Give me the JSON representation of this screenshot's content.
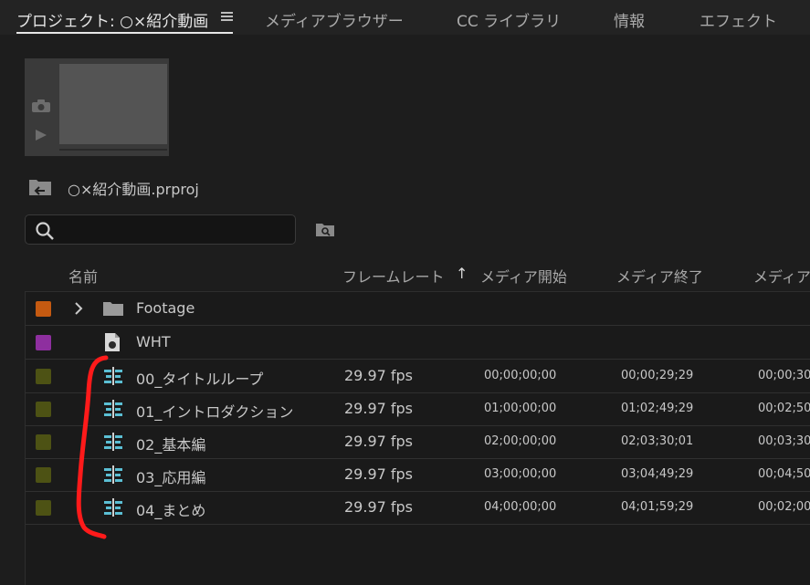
{
  "tabs": [
    {
      "label": "プロジェクト: ○×紹介動画"
    },
    {
      "label": "メディアブラウザー"
    },
    {
      "label": "CC ライブラリ"
    },
    {
      "label": "情報"
    },
    {
      "label": "エフェクト"
    }
  ],
  "project": {
    "file_name": "○×紹介動画.prproj"
  },
  "search": {
    "placeholder": "",
    "value": ""
  },
  "columns": {
    "name": "名前",
    "frame_rate": "フレームレート",
    "sort_arrow": "↑",
    "media_start": "メディア開始",
    "media_end": "メディア終了",
    "media_duration": "メディア"
  },
  "rows": [
    {
      "label_color": "#c55a11",
      "type": "folder",
      "name": "Footage",
      "fps": "",
      "start": "",
      "end": "",
      "duration": ""
    },
    {
      "label_color": "#8e2f9f",
      "type": "file",
      "name": "WHT",
      "fps": "",
      "start": "",
      "end": "",
      "duration": ""
    },
    {
      "label_color": "#4d5214",
      "type": "sequence",
      "name": "00_タイトルループ",
      "fps": "29.97 fps",
      "start": "00;00;00;00",
      "end": "00;00;29;29",
      "duration": "00;00;30"
    },
    {
      "label_color": "#4d5214",
      "type": "sequence",
      "name": "01_イントロダクション",
      "fps": "29.97 fps",
      "start": "01;00;00;00",
      "end": "01;02;49;29",
      "duration": "00;02;50"
    },
    {
      "label_color": "#4d5214",
      "type": "sequence",
      "name": "02_基本編",
      "fps": "29.97 fps",
      "start": "02;00;00;00",
      "end": "02;03;30;01",
      "duration": "00;03;30"
    },
    {
      "label_color": "#4d5214",
      "type": "sequence",
      "name": "03_応用編",
      "fps": "29.97 fps",
      "start": "03;00;00;00",
      "end": "03;04;49;29",
      "duration": "00;04;50"
    },
    {
      "label_color": "#4d5214",
      "type": "sequence",
      "name": "04_まとめ",
      "fps": "29.97 fps",
      "start": "04;00;00;00",
      "end": "04;01;59;29",
      "duration": "00;02;00"
    }
  ],
  "icons": {
    "panel_menu": "hamburger-menu-icon",
    "camera": "camera-icon",
    "play": "play-icon",
    "parent_folder": "parent-folder-icon",
    "search": "search-icon",
    "find": "find-icon",
    "expand": "chevron-right-icon",
    "folder": "folder-icon",
    "file": "file-icon",
    "sequence": "sequence-icon"
  },
  "colors": {
    "accent_annotation": "#ff1a1a",
    "sequence_icon": "#5bbfd4"
  }
}
